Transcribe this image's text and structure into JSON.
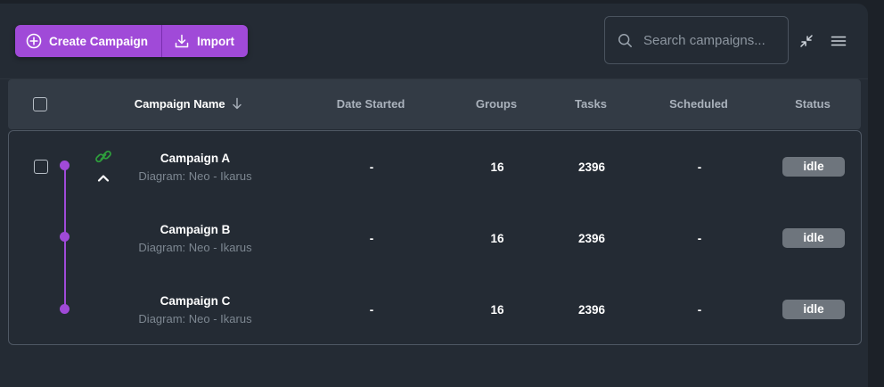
{
  "toolbar": {
    "create_label": "Create Campaign",
    "import_label": "Import"
  },
  "search": {
    "placeholder": "Search campaigns..."
  },
  "table": {
    "columns": {
      "name": "Campaign Name",
      "date_started": "Date Started",
      "groups": "Groups",
      "tasks": "Tasks",
      "scheduled": "Scheduled",
      "status": "Status"
    },
    "rows": [
      {
        "name": "Campaign A",
        "diagram": "Diagram: Neo - Ikarus",
        "date_started": "-",
        "groups": "16",
        "tasks": "2396",
        "scheduled": "-",
        "status": "idle"
      },
      {
        "name": "Campaign B",
        "diagram": "Diagram: Neo - Ikarus",
        "date_started": "-",
        "groups": "16",
        "tasks": "2396",
        "scheduled": "-",
        "status": "idle"
      },
      {
        "name": "Campaign C",
        "diagram": "Diagram: Neo - Ikarus",
        "date_started": "-",
        "groups": "16",
        "tasks": "2396",
        "scheduled": "-",
        "status": "idle"
      }
    ]
  },
  "icons": {
    "create": "plus-circle-icon",
    "import": "download-icon",
    "search": "search-icon",
    "collapse": "minimize-icon",
    "menu": "menu-icon",
    "sort": "arrow-down-icon",
    "link": "link-icon",
    "expand": "chevron-up-icon"
  },
  "colors": {
    "accent": "#a04ad8",
    "link_icon": "#2e9e3c",
    "status_idle": "#6e757d",
    "background": "#242b34"
  }
}
